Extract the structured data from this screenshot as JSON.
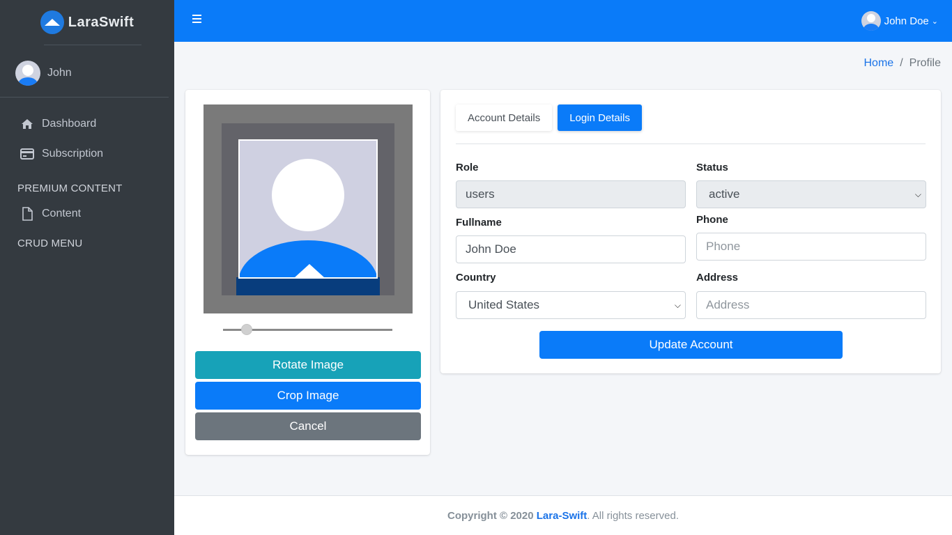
{
  "sidebar": {
    "brand": "LaraSwift",
    "user_name": "John",
    "nav": [
      {
        "label": "Dashboard",
        "icon": "home-icon"
      },
      {
        "label": "Subscription",
        "icon": "credit-card-icon"
      }
    ],
    "headers": {
      "premium": "PREMIUM CONTENT",
      "crud": "CRUD MENU"
    },
    "premium_items": [
      {
        "label": "Content",
        "icon": "file-icon"
      }
    ]
  },
  "topbar": {
    "user_name": "John Doe"
  },
  "breadcrumb": {
    "home": "Home",
    "separator": "/",
    "current": "Profile"
  },
  "image_editor": {
    "zoom_slider_value": 0.14,
    "buttons": {
      "rotate": "Rotate Image",
      "crop": "Crop Image",
      "cancel": "Cancel"
    }
  },
  "profile_form": {
    "tabs": [
      {
        "label": "Account Details",
        "active": false
      },
      {
        "label": "Login Details",
        "active": true
      }
    ],
    "fields": {
      "role": {
        "label": "Role",
        "value": "users"
      },
      "status": {
        "label": "Status",
        "value": "active"
      },
      "fullname": {
        "label": "Fullname",
        "value": "John Doe"
      },
      "phone": {
        "label": "Phone",
        "placeholder": "Phone"
      },
      "country": {
        "label": "Country",
        "value": "United States"
      },
      "address": {
        "label": "Address",
        "placeholder": "Address"
      }
    },
    "submit": "Update Account"
  },
  "footer": {
    "prefix": "Copyright © 2020 ",
    "brand": "Lara-Swift",
    "suffix": ". All rights reserved."
  },
  "colors": {
    "primary": "#0a7bf9",
    "info": "#17a2b8",
    "secondary": "#6c757d",
    "sidebar": "#343a40"
  }
}
